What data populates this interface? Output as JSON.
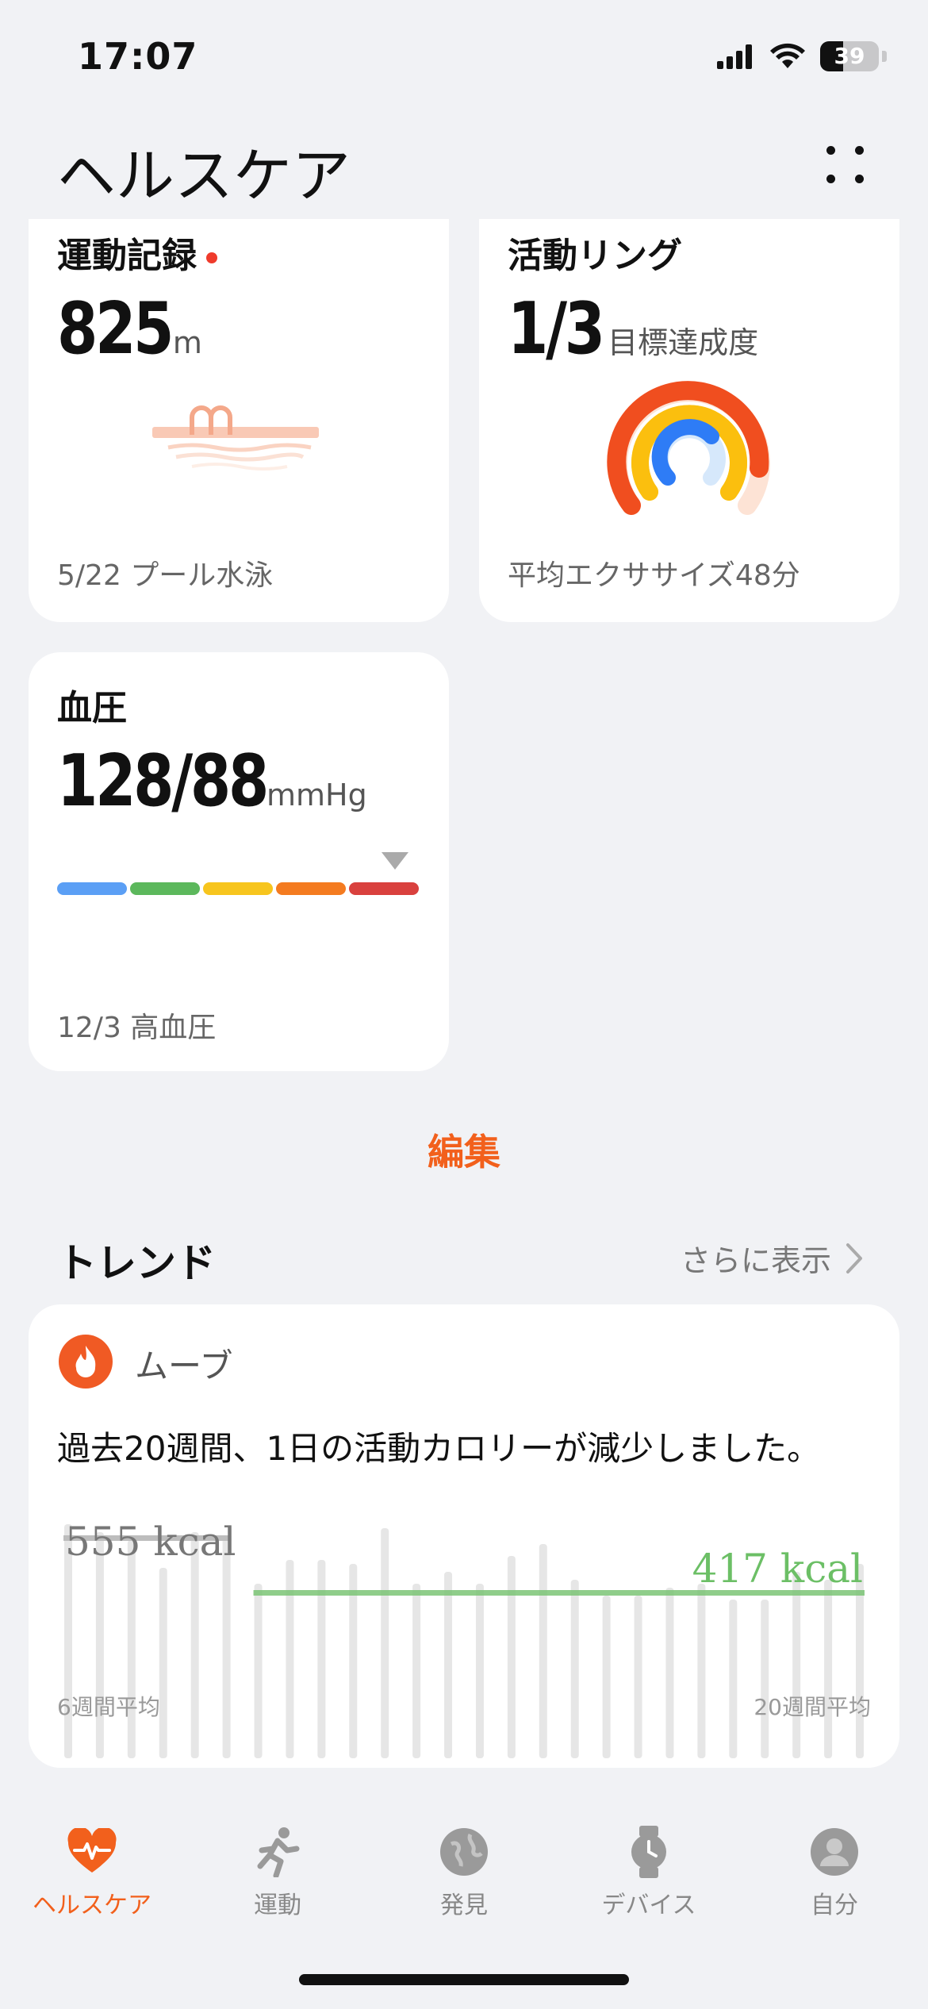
{
  "status_bar": {
    "time": "17:07",
    "battery": "39"
  },
  "header": {
    "title": "ヘルスケア"
  },
  "cards": {
    "exercise": {
      "title": "運動記録",
      "value": "825",
      "unit": "m",
      "footer": "5/22 プール水泳"
    },
    "activity_ring": {
      "title": "活動リング",
      "value": "1/3",
      "unit": "目標達成度",
      "footer": "平均エクササイズ48分"
    },
    "blood_pressure": {
      "title": "血圧",
      "value": "128/88",
      "unit": "mmHg",
      "footer": "12/3 高血圧",
      "scale_colors": [
        "#5b9ff5",
        "#5cb85c",
        "#f7c51e",
        "#f47b20",
        "#d9413e"
      ],
      "level_index": 4
    }
  },
  "edit_label": "編集",
  "trend": {
    "title": "トレンド",
    "more_label": "さらに表示",
    "card": {
      "category": "ムーブ",
      "message": "過去20週間、1日の活動カロリーが減少しました。",
      "avg6_label": "555 kcal",
      "avg20_label": "417 kcal",
      "left_caption": "6週間平均",
      "right_caption": "20週間平均"
    }
  },
  "chart_data": {
    "type": "bar",
    "title": "",
    "series": [
      {
        "values": [
          590,
          570,
          550,
          480,
          570,
          560,
          440,
          500,
          500,
          490,
          580,
          440,
          470,
          440,
          510,
          540,
          450,
          410,
          410,
          430,
          440,
          400,
          400,
          470,
          450,
          490
        ]
      }
    ],
    "reference_lines": [
      {
        "label": "555 kcal",
        "value": 555,
        "span": "first 6 weeks"
      },
      {
        "label": "417 kcal",
        "value": 417,
        "span": "20 weeks"
      }
    ]
  },
  "nav": {
    "items": [
      {
        "label": "ヘルスケア",
        "active": true,
        "icon": "heart-pulse-icon"
      },
      {
        "label": "運動",
        "active": false,
        "icon": "running-icon"
      },
      {
        "label": "発見",
        "active": false,
        "icon": "globe-icon"
      },
      {
        "label": "デバイス",
        "active": false,
        "icon": "watch-icon"
      },
      {
        "label": "自分",
        "active": false,
        "icon": "person-icon"
      }
    ]
  },
  "colors": {
    "accent": "#f2601c",
    "trend_green": "#7cc576",
    "card_bg": "#ffffff",
    "page_bg": "#f1f2f5"
  }
}
